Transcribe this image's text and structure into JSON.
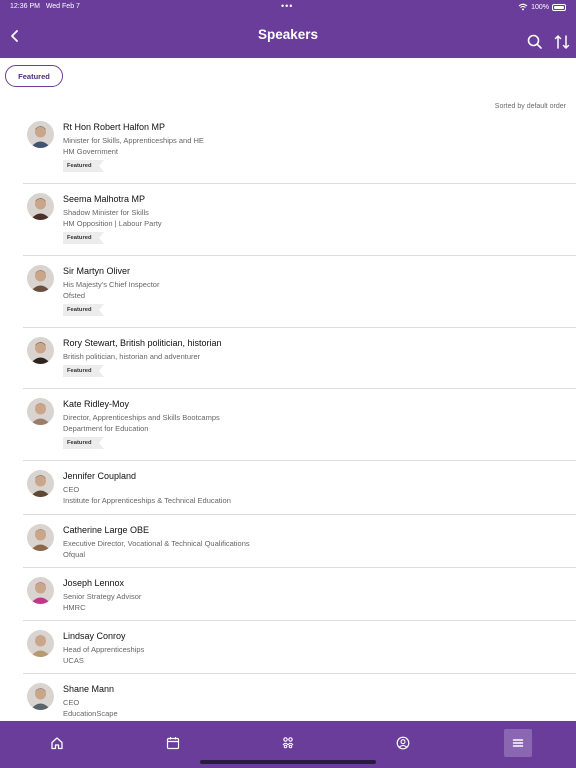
{
  "status_bar": {
    "time": "12:36 PM",
    "date": "Wed Feb 7",
    "dots": "•••",
    "battery": "100%"
  },
  "nav": {
    "title": "Speakers"
  },
  "filter": {
    "label": "Featured"
  },
  "sort_label": "Sorted by default order",
  "badge_label": "Featured",
  "speakers": [
    {
      "name": "Rt Hon Robert Halfon MP",
      "line1": "Minister for Skills, Apprenticeships and HE",
      "line2": "HM Government",
      "featured": true,
      "color": "#41536e"
    },
    {
      "name": "Seema Malhotra MP",
      "line1": "Shadow Minister for Skills",
      "line2": "HM Opposition | Labour Party",
      "featured": true,
      "color": "#4a3025"
    },
    {
      "name": "Sir Martyn Oliver",
      "line1": "His Majesty's Chief Inspector",
      "line2": "Ofsted",
      "featured": true,
      "color": "#6b5040"
    },
    {
      "name": "Rory Stewart, British politician, historian",
      "line1": "British politician, historian and adventurer",
      "line2": "",
      "featured": true,
      "color": "#2e2522"
    },
    {
      "name": "Kate Ridley-Moy",
      "line1": "Director, Apprenticeships and Skills Bootcamps",
      "line2": "Department for Education",
      "featured": true,
      "color": "#9a7e6a"
    },
    {
      "name": "Jennifer Coupland",
      "line1": "CEO",
      "line2": "Institute for Apprenticeships & Technical Education",
      "featured": false,
      "color": "#5e4a33"
    },
    {
      "name": "Catherine Large OBE",
      "line1": "Executive Director, Vocational & Technical Qualifications",
      "line2": "Ofqual",
      "featured": false,
      "color": "#8a6848"
    },
    {
      "name": "Joseph Lennox",
      "line1": "Senior Strategy Advisor",
      "line2": "HMRC",
      "featured": false,
      "color": "#c2378a"
    },
    {
      "name": "Lindsay Conroy",
      "line1": "Head of Apprenticeships",
      "line2": "UCAS",
      "featured": false,
      "color": "#b79a70"
    },
    {
      "name": "Shane Mann",
      "line1": "CEO",
      "line2": "EducationScape",
      "featured": false,
      "color": "#5b636b"
    }
  ],
  "tabs": [
    {
      "icon": "home-icon"
    },
    {
      "icon": "calendar-icon"
    },
    {
      "icon": "people-icon"
    },
    {
      "icon": "profile-icon"
    },
    {
      "icon": "menu-icon",
      "active": true
    }
  ],
  "colors": {
    "brand": "#6a3d9a"
  }
}
